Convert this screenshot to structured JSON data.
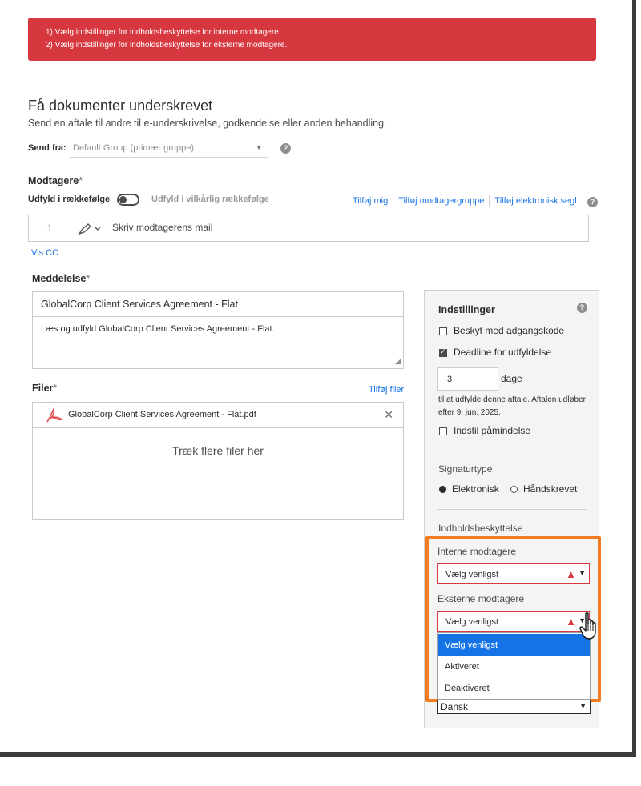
{
  "errors": [
    "1) Vælg indstillinger for indholdsbeskyttelse for interne modtagere.",
    "2) Vælg indstillinger for indholdsbeskyttelse for eksterne modtagere."
  ],
  "header": {
    "title": "Få dokumenter underskrevet",
    "subtitle": "Send en aftale til andre til e-underskrivelse, godkendelse eller anden behandling."
  },
  "send_from": {
    "label": "Send fra:",
    "value": "Default Group (primær gruppe)"
  },
  "recipients": {
    "label": "Modtagere",
    "required_mark": "*",
    "order_label": "Udfyld i rækkefølge",
    "any_order_label": "Udfyld i vilkårlig rækkefølge",
    "links": [
      "Tilføj mig",
      "Tilføj modtagergruppe",
      "Tilføj elektronisk segl"
    ],
    "row_number": "1",
    "email_placeholder": "Skriv modtagerens mail",
    "show_cc": "Vis CC"
  },
  "message": {
    "label": "Meddelelse",
    "required_mark": "*",
    "title_value": "GlobalCorp Client Services Agreement - Flat",
    "body_value": "Læs og udfyld GlobalCorp Client Services Agreement - Flat."
  },
  "files": {
    "label": "Filer",
    "required_mark": "*",
    "add_link": "Tilføj filer",
    "file_name": "GlobalCorp Client Services Agreement - Flat.pdf",
    "drop_text": "Træk flere filer her"
  },
  "settings": {
    "title": "Indstillinger",
    "password_label": "Beskyt med adgangskode",
    "password_checked": false,
    "deadline_label": "Deadline for udfyldelse",
    "deadline_checked": true,
    "days_value": "3",
    "days_unit": "dage",
    "deadline_note": "til at udfylde denne aftale. Aftalen udløber efter 9. jun. 2025.",
    "reminder_label": "Indstil påmindelse",
    "reminder_checked": false,
    "signature_type_label": "Signaturtype",
    "signature_options": [
      "Elektronisk",
      "Håndskrevet"
    ],
    "signature_selected": "Elektronisk",
    "content_protection_label": "Indholdsbeskyttelse",
    "internal_label": "Interne modtagere",
    "internal_value": "Vælg venligst",
    "external_label": "Eksterne modtagere",
    "external_value": "Vælg venligst",
    "dropdown_options": [
      "Vælg venligst",
      "Aktiveret",
      "Deaktiveret"
    ],
    "dropdown_highlighted": "Vælg venligst",
    "language_value": "Dansk"
  },
  "colors": {
    "error": "#d7373f",
    "link": "#1473e6",
    "highlight_outline": "#f47b20",
    "dropdown_active": "#1473e6"
  }
}
